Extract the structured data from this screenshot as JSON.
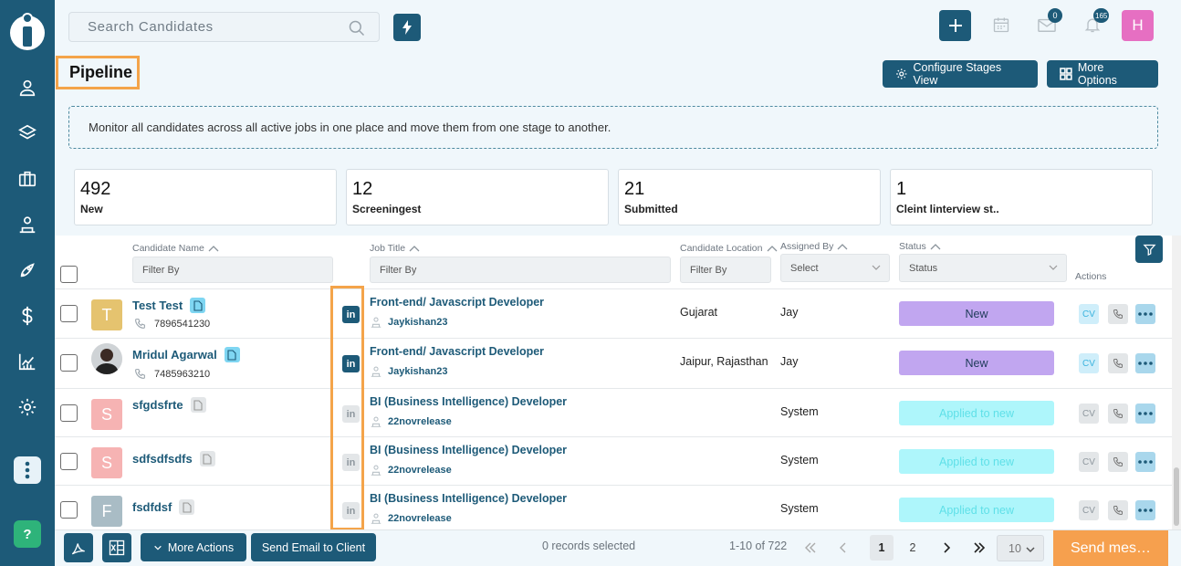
{
  "search": {
    "placeholder": "Search Candidates"
  },
  "topbar": {
    "mail_badge": "0",
    "bell_badge": "165",
    "user_initial": "H"
  },
  "header": {
    "title": "Pipeline",
    "configure_label": "Configure Stages View",
    "more_options_label": "More Options"
  },
  "info": "Monitor all candidates across all active jobs in one place and move them from one stage to another.",
  "stats": [
    {
      "count": "492",
      "label": "New"
    },
    {
      "count": "12",
      "label": "Screeningest"
    },
    {
      "count": "21",
      "label": "Submitted"
    },
    {
      "count": "1",
      "label": "Cleint linterview st.."
    }
  ],
  "table": {
    "columns": {
      "candidate_name": "Candidate Name",
      "job_title": "Job Title",
      "candidate_location": "Candidate Location",
      "assigned_by": "Assigned By",
      "status": "Status",
      "actions": "Actions"
    },
    "filters": {
      "name_placeholder": "Filter By",
      "job_placeholder": "Filter By",
      "location_placeholder": "Filter By",
      "assigned_value": "Select",
      "status_value": "Status"
    },
    "rows": [
      {
        "initial": "T",
        "name": "Test Test",
        "phone": "7896541230",
        "job": "Front-end/ Javascript Developer",
        "owner": "Jaykishan23",
        "location": "Gujarat",
        "assigned": "Jay",
        "status": "New",
        "cv": "CV"
      },
      {
        "initial": "",
        "name": "Mridul Agarwal",
        "phone": "7485963210",
        "job": "Front-end/ Javascript Developer",
        "owner": "Jaykishan23",
        "location": "Jaipur, Rajasthan",
        "assigned": "Jay",
        "status": "New",
        "cv": "CV"
      },
      {
        "initial": "S",
        "name": "sfgdsfrte",
        "phone": "",
        "job": "BI (Business Intelligence) Developer",
        "owner": "22novrelease",
        "location": "",
        "assigned": "System",
        "status": "Applied to new",
        "cv": "CV"
      },
      {
        "initial": "S",
        "name": "sdfsdfsdfs",
        "phone": "",
        "job": "BI (Business Intelligence) Developer",
        "owner": "22novrelease",
        "location": "",
        "assigned": "System",
        "status": "Applied to new",
        "cv": "CV"
      },
      {
        "initial": "F",
        "name": "fsdfdsf",
        "phone": "",
        "job": "BI (Business Intelligence) Developer",
        "owner": "22novrelease",
        "location": "",
        "assigned": "System",
        "status": "Applied to new",
        "cv": "CV"
      }
    ]
  },
  "footer": {
    "more_actions_label": "More Actions",
    "send_email_label": "Send Email to Client",
    "records_selected": "0 records selected",
    "range": "1-10 of 722",
    "page1": "1",
    "page2": "2",
    "page_size": "10",
    "send_message_label": "Send mes…"
  },
  "colors": {
    "brand": "#1d5a78",
    "highlight": "#f4a44a",
    "status_new": "#c1a6f0",
    "status_applied": "#aef6fb",
    "send_message": "#f6a04e"
  }
}
